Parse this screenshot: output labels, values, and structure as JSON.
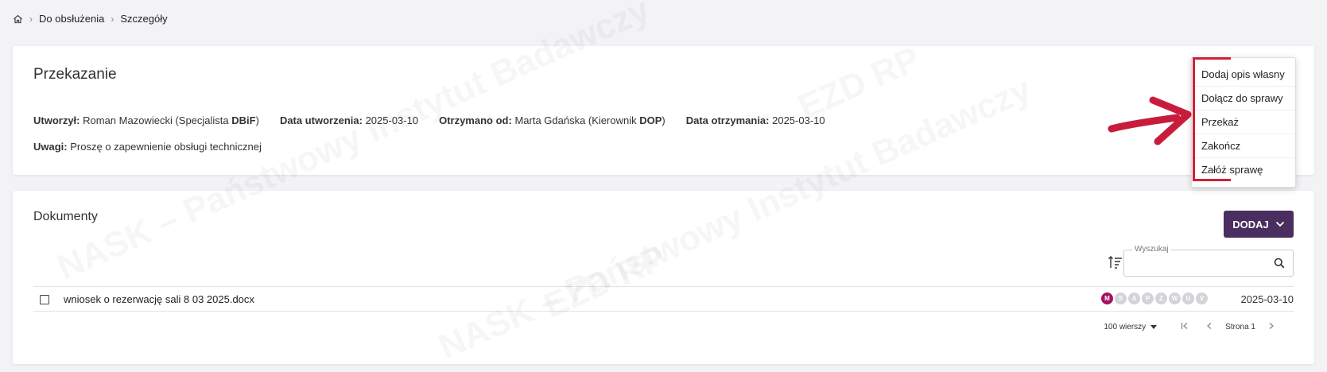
{
  "breadcrumb": {
    "home_icon": "home-icon",
    "items": [
      "Do obsłużenia",
      "Szczegóły"
    ],
    "separator": "›"
  },
  "transfer": {
    "title": "Przekazanie",
    "created_by_label": "Utworzył:",
    "created_by_value": "Roman Mazowiecki (Specjalista ",
    "created_by_unit": "DBiF",
    "created_by_end": ")",
    "created_date_label": "Data utworzenia:",
    "created_date_value": "2025-03-10",
    "received_from_label": "Otrzymano od:",
    "received_from_value": "Marta Gdańska (Kierownik ",
    "received_from_unit": "DOP",
    "received_from_end": ")",
    "received_date_label": "Data otrzymania:",
    "received_date_value": "2025-03-10",
    "notes_label": "Uwagi:",
    "notes_value": "Proszę o zapewnienie obsługi technicznej"
  },
  "menu": {
    "items": [
      "Dodaj opis własny",
      "Dołącz do sprawy",
      "Przekaż",
      "Zakończ",
      "Załóż sprawę"
    ]
  },
  "documents": {
    "title": "Dokumenty",
    "add_button_label": "DODAJ",
    "search_label": "Wyszukaj",
    "search_placeholder": "",
    "rows": [
      {
        "name": "wniosek o rezerwację sali 8 03 2025.docx",
        "badges": [
          "M",
          "S",
          "A",
          "P",
          "Z",
          "W",
          "U",
          "V"
        ],
        "active_badge": "M",
        "date": "2025-03-10"
      }
    ],
    "pagination": {
      "rows_per_page": "100 wierszy",
      "page_label": "Strona 1"
    }
  },
  "watermark": {
    "text_1": "NASK – Państwowy Instytut Badawczy",
    "text_2": "EZD RP"
  },
  "colors": {
    "accent": "#4a2e5f",
    "badge_active": "#a3125e",
    "annotation_red": "#d0203a"
  }
}
